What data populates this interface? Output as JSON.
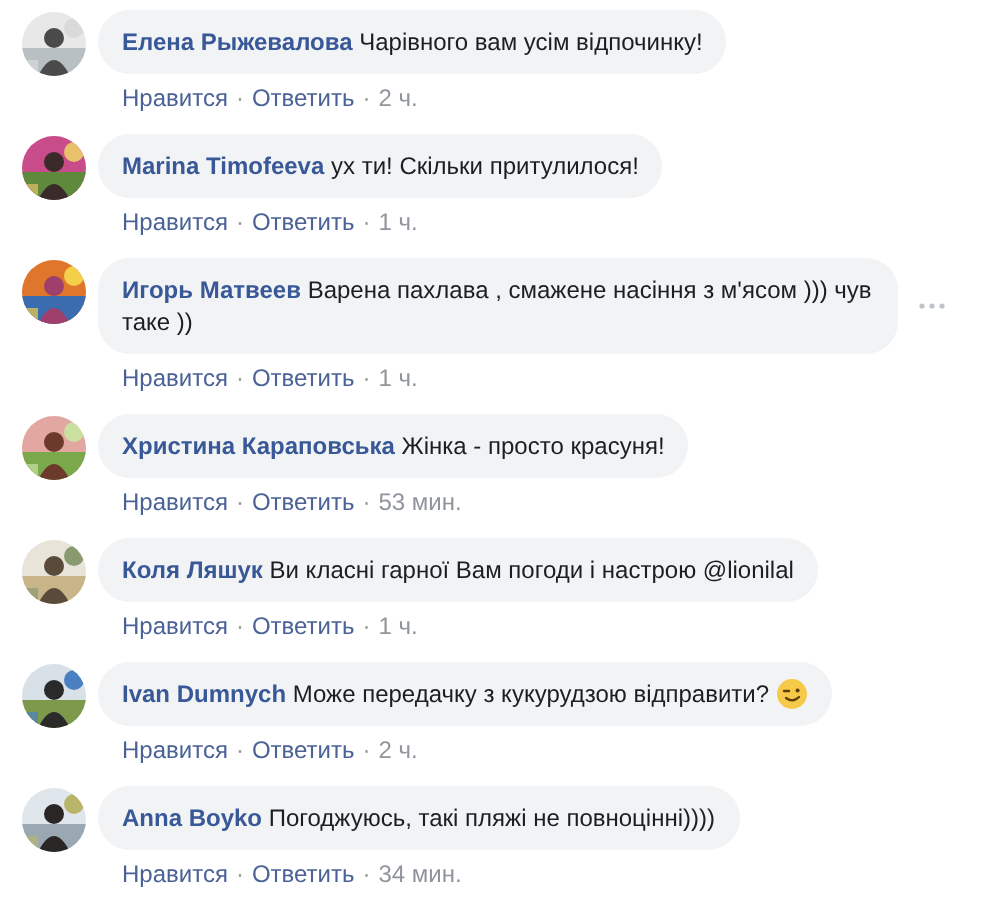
{
  "separator": "·",
  "comments": [
    {
      "author": "Елена Рыжевалова",
      "text": "Чарівного вам усім відпочинку!",
      "like": "Нравится",
      "reply": "Ответить",
      "time": "2 ч.",
      "show_menu": false
    },
    {
      "author": "Marina Timofeeva",
      "text": "ух ти! Скільки притулилося!",
      "like": "Нравится",
      "reply": "Ответить",
      "time": "1 ч.",
      "show_menu": false
    },
    {
      "author": "Игорь Матвеев",
      "text": "Варена пахлава , смажене насіння з м'ясом ))) чув таке ))",
      "like": "Нравится",
      "reply": "Ответить",
      "time": "1 ч.",
      "show_menu": true
    },
    {
      "author": "Христина Караповська",
      "text": "Жінка - просто красуня!",
      "like": "Нравится",
      "reply": "Ответить",
      "time": "53 мин.",
      "show_menu": false
    },
    {
      "author": "Коля Ляшук",
      "text": "Ви класні гарної Вам погоди і настрою @lionilal",
      "like": "Нравится",
      "reply": "Ответить",
      "time": "1 ч.",
      "show_menu": false
    },
    {
      "author": "Ivan Dumnych",
      "text": "Може передачку з кукурудзою відправити?",
      "wink_emoji": true,
      "like": "Нравится",
      "reply": "Ответить",
      "time": "2 ч.",
      "show_menu": false
    },
    {
      "author": "Anna Boyko",
      "text": "Погоджуюсь, такі пляжі не повноцінні))))",
      "like": "Нравится",
      "reply": "Ответить",
      "time": "34 мин.",
      "show_menu": false
    }
  ]
}
